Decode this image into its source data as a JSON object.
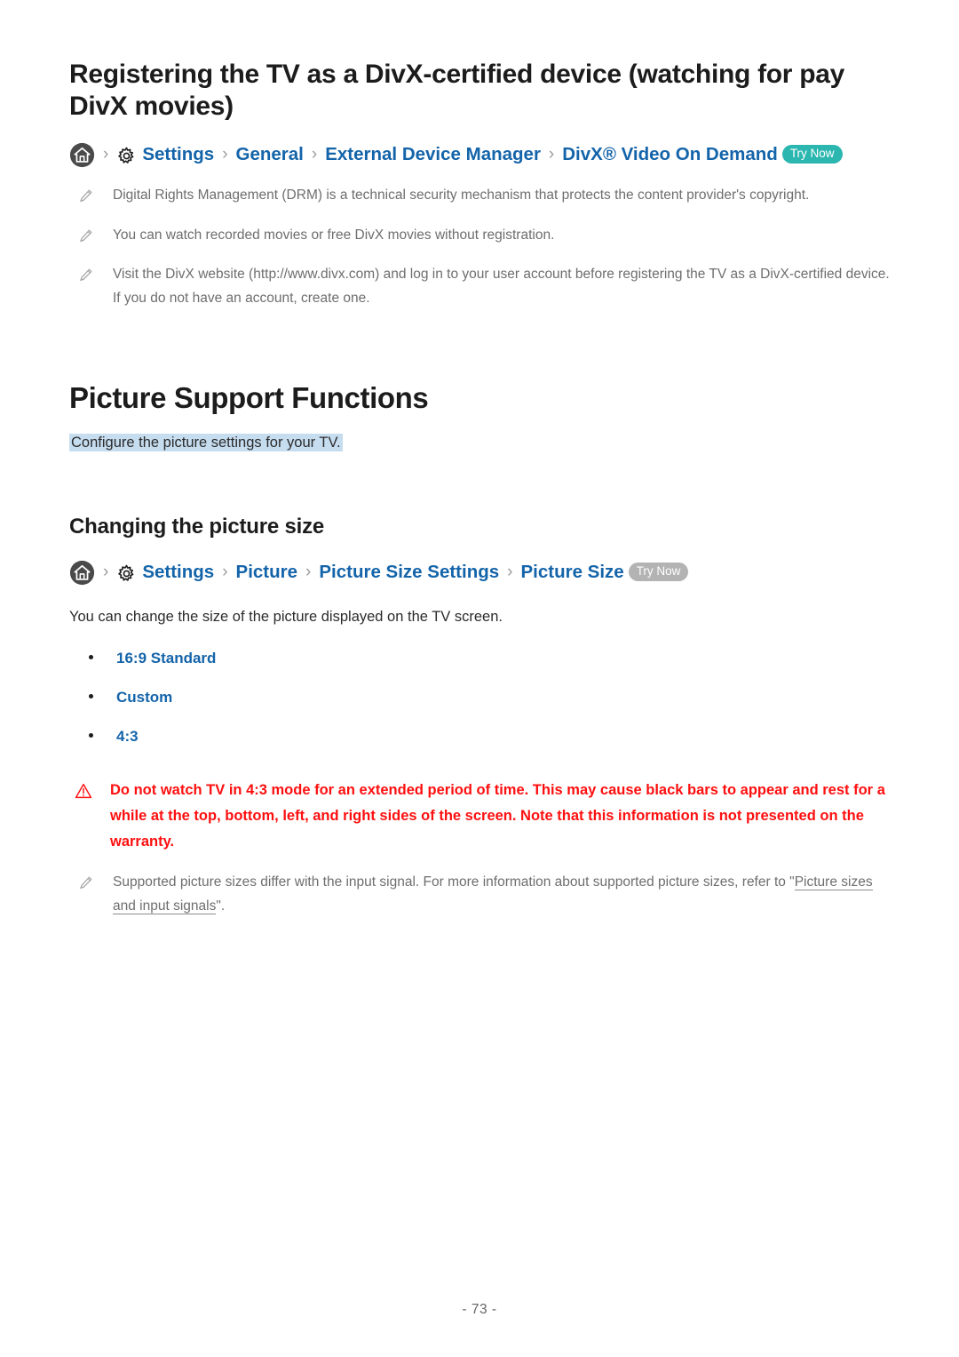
{
  "topic": {
    "heading": "Registering the TV as a DivX-certified device (watching for pay DivX movies)",
    "breadcrumb": {
      "home_icon": "home-icon",
      "gear_icon": "gear-icon",
      "separator": "›",
      "crumbs": [
        "Settings",
        "General",
        "External Device Manager",
        "DivX® Video On Demand"
      ],
      "badge_label": "Try Now",
      "badge_color": "#2bb6b0"
    },
    "notes": [
      "Digital Rights Management (DRM) is a technical security mechanism that protects the content provider's copyright.",
      "You can watch recorded movies or free DivX movies without registration."
    ],
    "note_link": {
      "before": "Visit the DivX website (http://www.divx.com) and log in to your user account before registering the TV as a DivX-certified device. If you do not have an account, create one.",
      "icon": "pencil-icon"
    }
  },
  "section": {
    "heading": "Picture Support Functions",
    "subtitle": "Configure the picture settings for your TV.",
    "subtitle_highlight": "#c6dcef"
  },
  "subsection": {
    "heading": "Changing the picture size",
    "breadcrumb": {
      "home_icon": "home-icon",
      "gear_icon": "gear-icon",
      "separator": "›",
      "crumbs": [
        "Settings",
        "Picture",
        "Picture Size Settings",
        "Picture Size"
      ],
      "badge_label": "Try Now",
      "badge_color": "#b3b3b3"
    },
    "intro": "You can change the size of the picture displayed on the TV screen.",
    "options": [
      "16:9 Standard",
      "Custom",
      "4:3"
    ],
    "caution": {
      "icon": "warning-triangle-icon",
      "text": "Do not watch TV in 4:3 mode for an extended period of time. This may cause black bars to appear and rest for a while at the top, bottom, left, and right sides of the screen. Note that this information is not presented on the warranty.",
      "color": "#ff0f0f"
    },
    "final_note": {
      "icon": "pencil-icon",
      "text_before": "Supported picture sizes differ with the input signal. For more information about supported picture sizes, refer to \"",
      "xref": "Picture sizes and input signals",
      "text_after": "\"."
    }
  },
  "footer": {
    "page_number": "- 73 -"
  }
}
